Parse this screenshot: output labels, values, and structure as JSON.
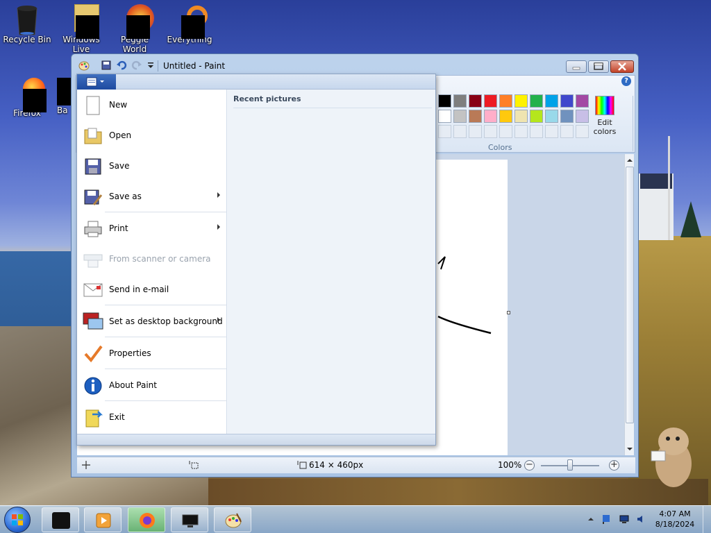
{
  "desktop": {
    "icons": [
      {
        "label": "Recycle Bin"
      },
      {
        "label": "Windows Live"
      },
      {
        "label": "Peggle World"
      },
      {
        "label": "Everything"
      },
      {
        "label": "Firefox"
      },
      {
        "label": "Ba"
      }
    ]
  },
  "window": {
    "title": "Untitled - Paint",
    "help": "?",
    "colors_label": "Colors",
    "edit_colors_label": "Edit colors",
    "palette_row1": [
      "#000000",
      "#7f7f7f",
      "#880015",
      "#ed1c24",
      "#ff7f27",
      "#fff200",
      "#22b14c",
      "#00a2e8",
      "#3f48cc",
      "#a349a4"
    ],
    "palette_row2": [
      "#ffffff",
      "#c3c3c3",
      "#b97a57",
      "#ffaec9",
      "#ffc90e",
      "#efe4b0",
      "#b5e61d",
      "#99d9ea",
      "#7092be",
      "#c8bfe7"
    ]
  },
  "app_menu": {
    "items": [
      {
        "label": "New",
        "has_submenu": false,
        "enabled": true
      },
      {
        "label": "Open",
        "has_submenu": false,
        "enabled": true
      },
      {
        "label": "Save",
        "has_submenu": false,
        "enabled": true
      },
      {
        "label": "Save as",
        "has_submenu": true,
        "enabled": true
      },
      {
        "label": "Print",
        "has_submenu": true,
        "enabled": true
      },
      {
        "label": "From scanner or camera",
        "has_submenu": false,
        "enabled": false
      },
      {
        "label": "Send in e-mail",
        "has_submenu": false,
        "enabled": true
      },
      {
        "label": "Set as desktop background",
        "has_submenu": true,
        "enabled": true
      },
      {
        "label": "Properties",
        "has_submenu": false,
        "enabled": true
      },
      {
        "label": "About Paint",
        "has_submenu": false,
        "enabled": true
      },
      {
        "label": "Exit",
        "has_submenu": false,
        "enabled": true
      }
    ],
    "recent_title": "Recent pictures"
  },
  "statusbar": {
    "image_size": "614 × 460px",
    "zoom_level": "100%",
    "zoom_minus": "−",
    "zoom_plus": "+"
  },
  "taskbar": {
    "time": "4:07 AM",
    "date": "8/18/2024"
  }
}
